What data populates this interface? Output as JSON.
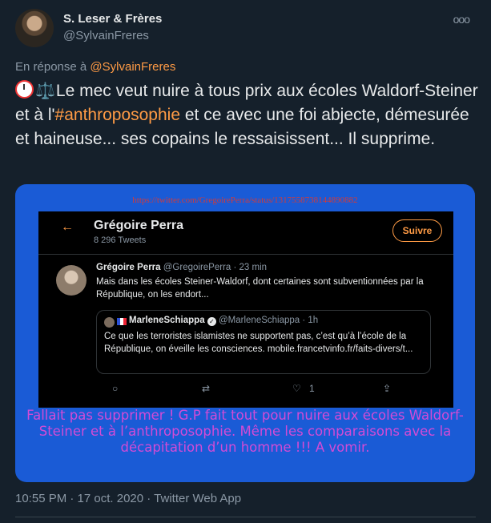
{
  "author": {
    "name": "S. Leser & Frères",
    "handle": "@SylvainFreres"
  },
  "more_label": "ooo",
  "reply_to": {
    "prefix": "En réponse à",
    "user": "@SylvainFreres"
  },
  "tweet": {
    "emoji_1": "clock-emoji",
    "emoji_2": "⚖️",
    "part1": "Le mec veut nuire à tous prix aux écoles Waldorf-Steiner et à l'",
    "hashtag": "#anthroposophie",
    "part2": " et ce avec une foi abjecte, démesurée et haineuse... ses copains le ressaisissent... Il supprime."
  },
  "image": {
    "url": "https://twitter.com/GregoirePerra/status/1317558738144890882",
    "profile": {
      "back": "←",
      "name": "Grégoire Perra",
      "count": "8 296 Tweets",
      "follow": "Suivre"
    },
    "post": {
      "author": "Grégoire Perra",
      "meta": "@GregoirePerra · 23 min",
      "text": "Mais dans les écoles Steiner-Waldorf, dont certaines sont subventionnées par la République, on les endort..."
    },
    "quote": {
      "author": "MarleneSchiappa",
      "verified": "✓",
      "meta": "@MarleneSchiappa · 1h",
      "text": "Ce que les terroristes islamistes ne supportent pas, c’est qu’à l’école de la République, on éveille les consciences. mobile.francetvinfo.fr/faits-divers/t..."
    },
    "actions": {
      "reply": "○",
      "retweet": "⇄",
      "like": "♡",
      "like_count": "1",
      "share": "⇪"
    },
    "caption": "Fallait pas supprimer ! G.P fait tout pour nuire aux écoles Waldorf-Steiner et à l’anthroposophie. Même les comparaisons avec la décapitation d’un homme !!! A vomir."
  },
  "timestamp": "10:55 PM · 17 oct. 2020 · Twitter Web App",
  "colors": {
    "background": "#15202b",
    "accent": "#ff9b45",
    "card": "#1a5bd6",
    "caption": "#d24bd6",
    "url": "#d23b3b"
  }
}
